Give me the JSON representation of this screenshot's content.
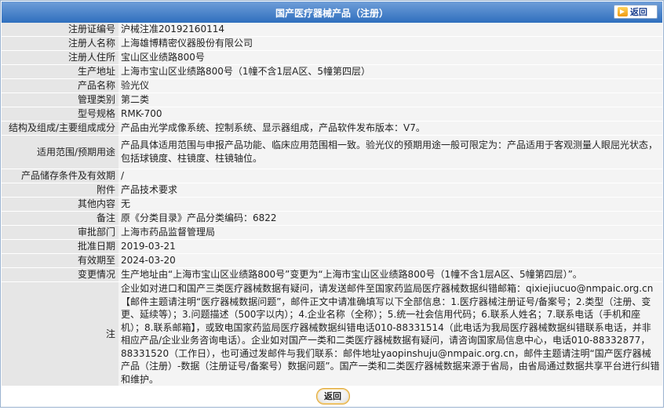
{
  "title": "国产医疗器械产品（注册）",
  "top_back_label": "返回",
  "bottom_back_label": "返回",
  "fields": [
    {
      "label": "注册证编号",
      "value": "沪械注准20192160114"
    },
    {
      "label": "注册人名称",
      "value": "上海雄博精密仪器股份有限公司"
    },
    {
      "label": "注册人住所",
      "value": "宝山区业绩路800号"
    },
    {
      "label": "生产地址",
      "value": "上海市宝山区业绩路800号（1幢不含1层A区、5幢第四层）"
    },
    {
      "label": "产品名称",
      "value": "验光仪"
    },
    {
      "label": "管理类别",
      "value": "第二类"
    },
    {
      "label": "型号规格",
      "value": "RMK-700"
    },
    {
      "label": "结构及组成/主要组成成分",
      "value": "产品由光学成像系统、控制系统、显示器组成，产品软件发布版本：V7。"
    },
    {
      "label": "适用范围/预期用途",
      "value": "产品具体适用范围与申报产品功能、临床应用范围相一致。验光仪的预期用途一般可限定为：产品适用于客观测量人眼屈光状态，包括球镜度、柱镜度、柱镜轴位。"
    },
    {
      "label": "产品储存条件及有效期",
      "value": "/"
    },
    {
      "label": "附件",
      "value": "产品技术要求"
    },
    {
      "label": "其他内容",
      "value": "无"
    },
    {
      "label": "备注",
      "value": "原《分类目录》产品分类编码：6822"
    },
    {
      "label": "审批部门",
      "value": "上海市药品监督管理局"
    },
    {
      "label": "批准日期",
      "value": "2019-03-21"
    },
    {
      "label": "有效期至",
      "value": "2024-03-20"
    },
    {
      "label": "变更情况",
      "value": "生产地址由“上海市宝山区业绩路800号”变更为“上海市宝山区业绩路800号（1幢不含1层A区、5幢第四层）”。"
    },
    {
      "label": "注",
      "value": "企业如对进口和国产三类医疗器械数据有疑问，请发送邮件至国家药监局医疗器械数据纠错邮箱：qixiejiucuo@nmpaic.org.cn【邮件主题请注明“医疗器械数据问题”，邮件正文中请准确填写以下全部信息：1.医疗器械注册证号/备案号；2.类型（注册、变更、延续等）；3.问题描述（500字以内）；4.企业名称（全称）；5.统一社会信用代码；6.联系人姓名；7.联系电话（手机和座机）；8.联系邮箱】，或致电国家药监局医疗器械数据纠错电话010-88331514（此电话为我局医疗器械数据纠错联系电话，并非相应产品/企业业务咨询电话）。企业如对国产一类和二类医疗器械数据有疑问，请咨询国家局信息中心，电话010-88332877，88331520（工作日），也可通过发邮件与我们联系：邮件地址yaopinshuju@nmpaic.org.cn，邮件主题请注明“国产医疗器械产品（注册）-数据（注册证号/备案号）数据问题”。国产一类和二类医疗器械数据来源于省局，由省局通过数据共享平台进行纠错和维护。"
    }
  ],
  "colors": {
    "header": "#2f6fbe",
    "label_bg": "#e6e6e6",
    "value_bg": "#f4f4f4"
  }
}
